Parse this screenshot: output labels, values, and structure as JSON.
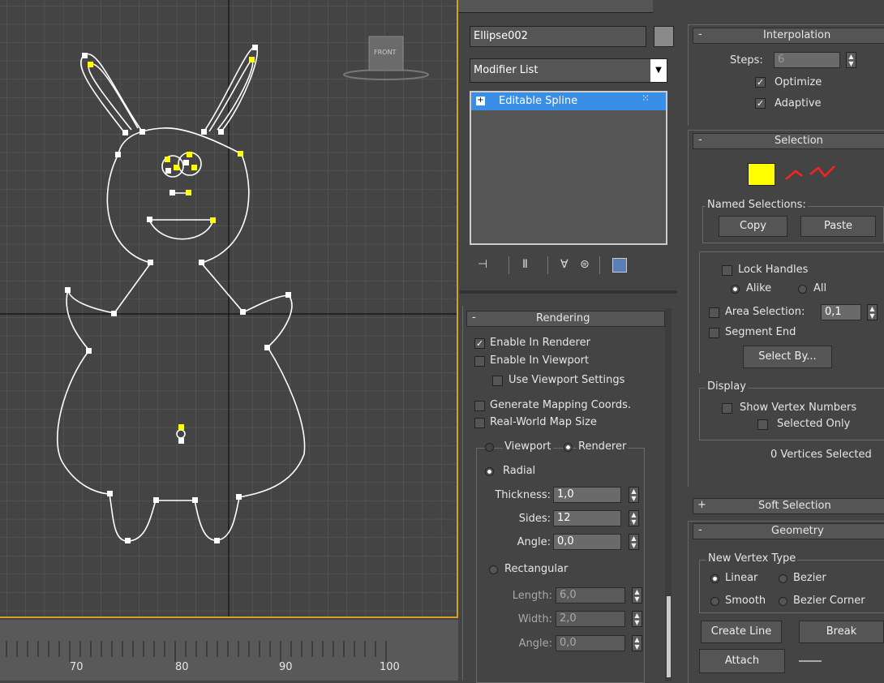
{
  "viewport": {
    "view_label": "FRONT"
  },
  "timeline": {
    "ticks": [
      "70",
      "80",
      "90",
      "100"
    ]
  },
  "command_panel": {
    "object_name": "Ellipse002",
    "modifier_list": "Modifier List",
    "stack_item": "Editable Spline",
    "rendering": {
      "title": "Rendering",
      "enable_in_renderer": "Enable In Renderer",
      "enable_in_viewport": "Enable In Viewport",
      "use_viewport_settings": "Use Viewport Settings",
      "generate_mapping": "Generate Mapping Coords.",
      "real_world_map_size": "Real-World Map Size",
      "viewport": "Viewport",
      "renderer": "Renderer",
      "radial": "Radial",
      "thickness_label": "Thickness:",
      "thickness": "1,0",
      "sides_label": "Sides:",
      "sides": "12",
      "angle_label": "Angle:",
      "angle": "0,0",
      "rectangular": "Rectangular",
      "length_label": "Length:",
      "length": "6,0",
      "width_label": "Width:",
      "width": "2,0",
      "angle2_label": "Angle:",
      "angle2": "0,0"
    }
  },
  "right_panel": {
    "interpolation": {
      "title": "Interpolation",
      "steps_label": "Steps:",
      "steps": "6",
      "optimize": "Optimize",
      "adaptive": "Adaptive"
    },
    "selection": {
      "title": "Selection",
      "named_selections": "Named Selections:",
      "copy": "Copy",
      "paste": "Paste",
      "lock_handles": "Lock Handles",
      "alike": "Alike",
      "all": "All",
      "area_selection": "Area Selection:",
      "area_value": "0,1",
      "segment_end": "Segment End",
      "select_by": "Select By...",
      "display": "Display",
      "show_vertex_numbers": "Show Vertex Numbers",
      "selected_only": "Selected Only",
      "status": "0 Vertices Selected"
    },
    "soft_selection": {
      "title": "Soft Selection"
    },
    "geometry": {
      "title": "Geometry",
      "new_vertex_type": "New Vertex Type",
      "linear": "Linear",
      "bezier": "Bezier",
      "smooth": "Smooth",
      "bezier_corner": "Bezier Corner",
      "create_line": "Create Line",
      "break": "Break",
      "attach": "Attach"
    }
  },
  "colors": {
    "viewport_border": "#d4a020",
    "selection_highlight": "#3a8ee6",
    "vertex_selected": "#ffff00",
    "subobject_red": "#ff2020"
  }
}
